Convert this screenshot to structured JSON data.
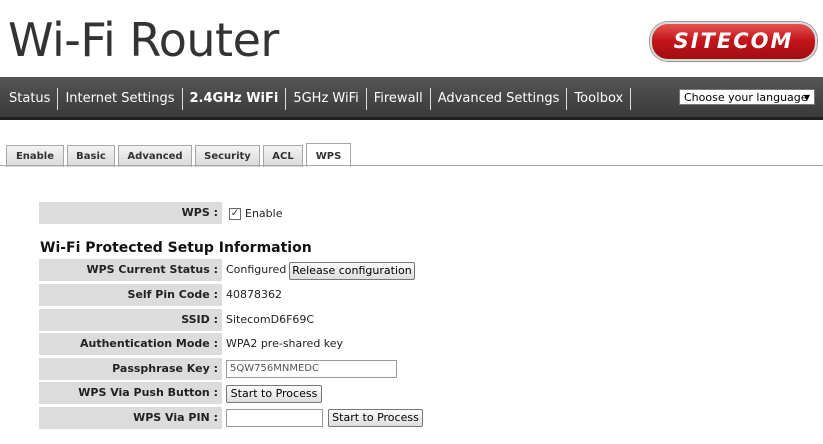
{
  "header": {
    "title": "Wi-Fi Router",
    "logo_text": "SITECOM"
  },
  "nav": {
    "items": [
      {
        "label": "Status"
      },
      {
        "label": "Internet Settings"
      },
      {
        "label": "2.4GHz WiFi"
      },
      {
        "label": "5GHz WiFi"
      },
      {
        "label": "Firewall"
      },
      {
        "label": "Advanced Settings"
      },
      {
        "label": "Toolbox"
      }
    ],
    "active": "2.4GHz WiFi",
    "language_select": {
      "value": "Choose your language"
    }
  },
  "tabs": [
    {
      "label": "Enable"
    },
    {
      "label": "Basic"
    },
    {
      "label": "Advanced"
    },
    {
      "label": "Security"
    },
    {
      "label": "ACL"
    },
    {
      "label": "WPS"
    }
  ],
  "active_tab": "WPS",
  "wps": {
    "label": "WPS :",
    "checked": true,
    "checkbox_label": "Enable"
  },
  "section_title": "Wi-Fi Protected Setup Information",
  "info": {
    "current_status": {
      "label": "WPS Current Status :",
      "value": "Configured",
      "button": "Release configuration"
    },
    "self_pin": {
      "label": "Self Pin Code :",
      "value": "40878362"
    },
    "ssid": {
      "label": "SSID :",
      "value": "SitecomD6F69C"
    },
    "auth_mode": {
      "label": "Authentication Mode :",
      "value": "WPA2 pre-shared key"
    },
    "passphrase": {
      "label": "Passphrase Key :",
      "value": "5QW756MNMEDC"
    },
    "push_button": {
      "label": "WPS Via Push Button :",
      "button": "Start to Process"
    },
    "via_pin": {
      "label": "WPS Via PIN :",
      "value": "",
      "button": "Start to Process"
    }
  },
  "colors": {
    "navbar": "#3f3f3f",
    "label_bg": "#dcdcdc",
    "logo_red": "#c4161c"
  }
}
